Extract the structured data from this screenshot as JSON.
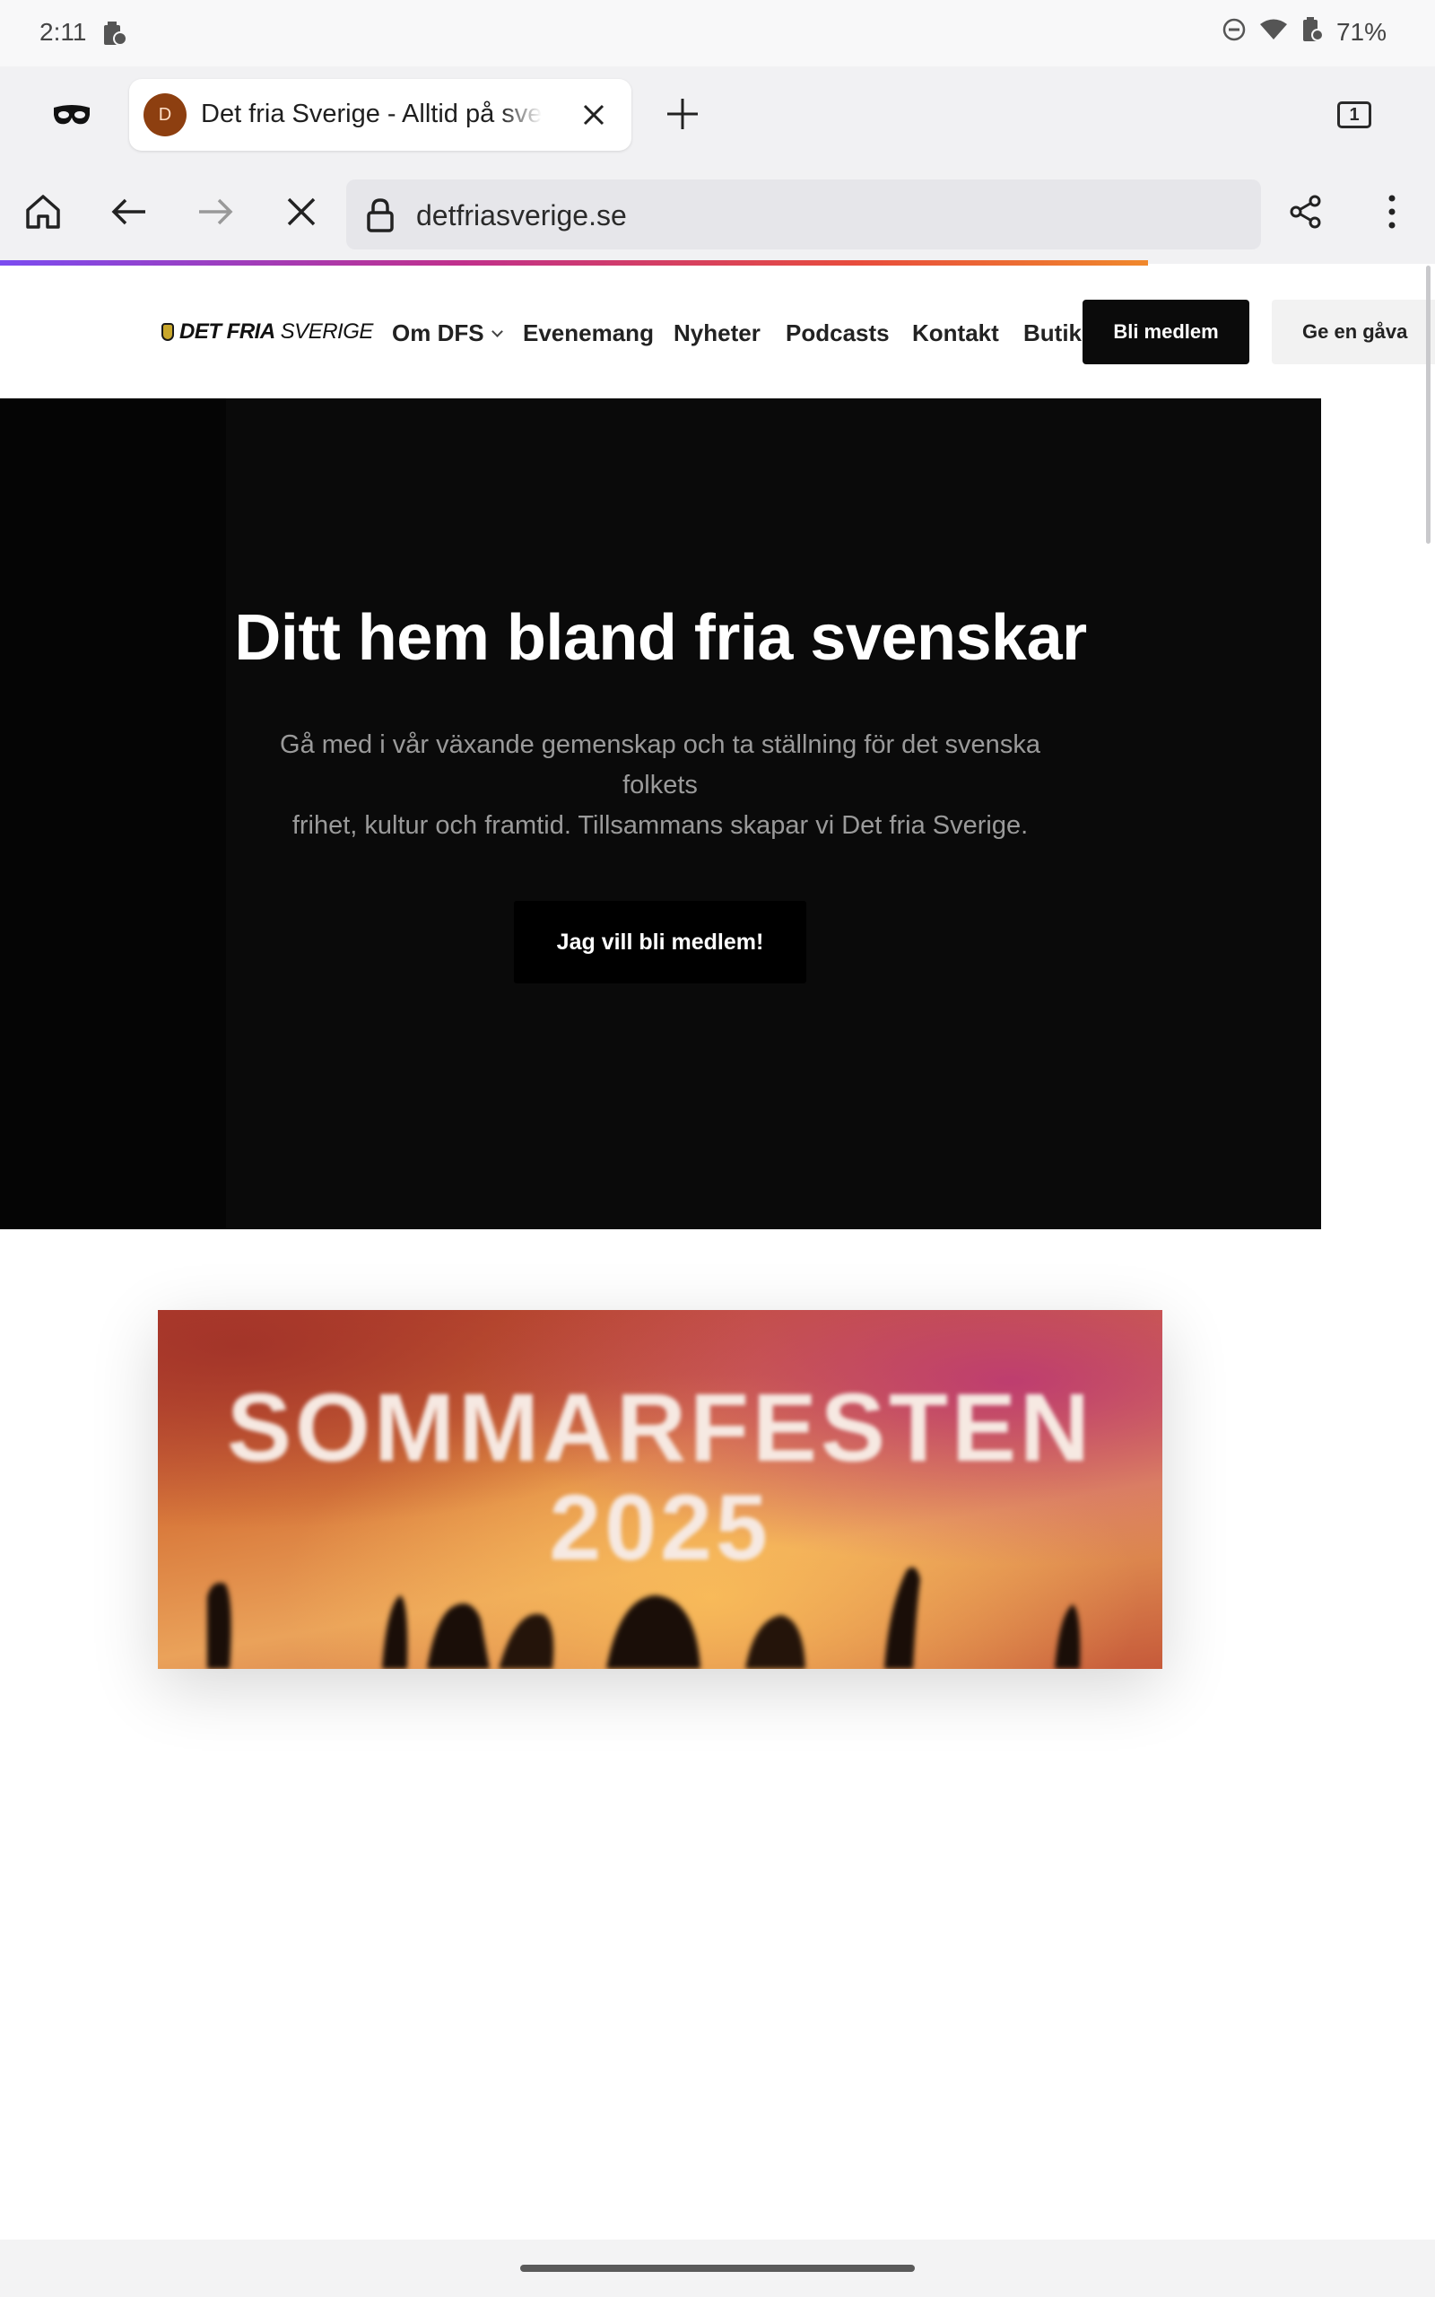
{
  "status_bar": {
    "time": "2:11",
    "battery_percent": "71%",
    "icons": [
      "work-profile-icon",
      "do-not-disturb-icon",
      "wifi-icon",
      "battery-icon"
    ]
  },
  "browser": {
    "tab": {
      "favicon_letter": "D",
      "title": "Det fria Sverige - Alltid på svenskarnas sida"
    },
    "tab_count": "1",
    "url": "detfriasverige.se",
    "page_load_progress": 0.8,
    "accent_colors": [
      "#7b4cf0",
      "#c0308c",
      "#e84d3c",
      "#f0882c"
    ]
  },
  "site": {
    "logo": {
      "bold": "DET FRIA",
      "light": "SVERIGE"
    },
    "nav": {
      "om_dfs": "Om DFS",
      "evenemang": "Evenemang",
      "nyheter": "Nyheter",
      "podcasts": "Podcasts",
      "kontakt": "Kontakt",
      "butik": "Butik",
      "join_button": "Bli medlem",
      "gift_button": "Ge en gåva"
    },
    "hero": {
      "title": "Ditt hem bland fria svenskar",
      "text_line1": "Gå med i vår växande gemenskap och ta ställning för det svenska folkets",
      "text_line2": "frihet,  kultur och framtid. Tillsammans skapar vi Det fria Sverige.",
      "cta": "Jag vill bli medlem!"
    },
    "banner": {
      "title": "SOMMARFESTEN",
      "year": "2025"
    }
  }
}
